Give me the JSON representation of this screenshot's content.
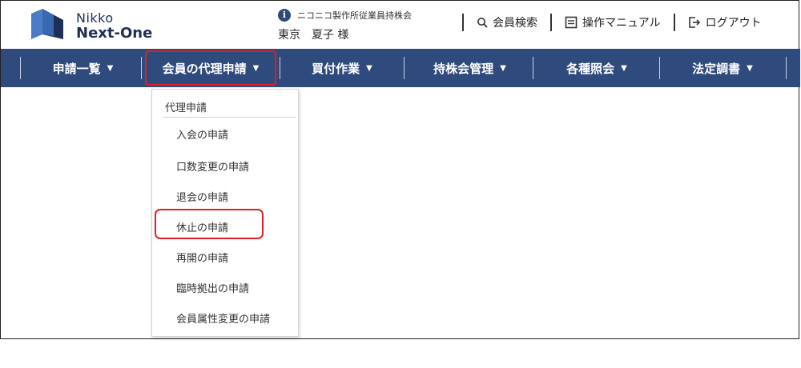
{
  "header": {
    "logo_line1": "Nikko",
    "logo_line2": "Next-One",
    "company_name": "ニコニコ製作所従業員持株会",
    "user_name": "東京　夏子 様",
    "links": {
      "member_search": "会員検索",
      "manual": "操作マニュアル",
      "logout": "ログアウト"
    }
  },
  "nav": {
    "items": [
      {
        "label": "申請一覧"
      },
      {
        "label": "会員の代理申請"
      },
      {
        "label": "買付作業"
      },
      {
        "label": "持株会管理"
      },
      {
        "label": "各種照会"
      },
      {
        "label": "法定調書"
      }
    ],
    "active_index": 1
  },
  "dropdown": {
    "header": "代理申請",
    "items": [
      {
        "label": "入会の申請"
      },
      {
        "label": "口数変更の申請"
      },
      {
        "label": "退会の申請"
      },
      {
        "label": "休止の申請"
      },
      {
        "label": "再開の申請"
      },
      {
        "label": "臨時拠出の申請"
      },
      {
        "label": "会員属性変更の申請"
      }
    ],
    "highlighted_index": 3
  },
  "colors": {
    "navbar": "#2f4a7c",
    "highlight": "#e02020",
    "brand_dark": "#1f2f55",
    "brand_light": "#4a7cc7"
  },
  "icons": [
    "logo-icon",
    "info-icon",
    "search-icon",
    "manual-icon",
    "logout-icon",
    "caret-down-icon"
  ]
}
